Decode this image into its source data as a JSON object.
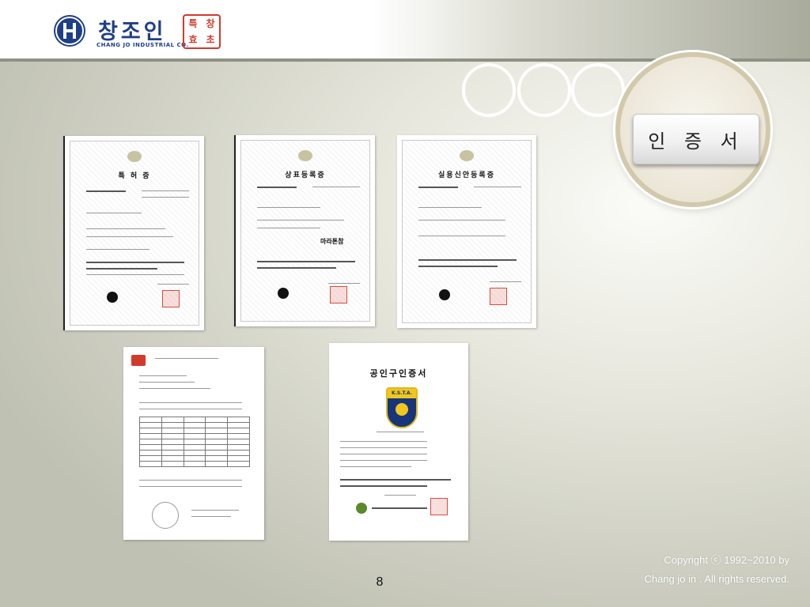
{
  "header": {
    "company_korean": "창조인",
    "company_english": "CHANG JO INDUSTRIAL CO.",
    "seal_text": [
      "특",
      "창",
      "효",
      "초"
    ]
  },
  "slide": {
    "title": "인 증 서",
    "page_number": "8"
  },
  "certificates": [
    {
      "heading": "특 허 증"
    },
    {
      "heading": "상표등록증",
      "brand": "마라톤참"
    },
    {
      "heading": "실용신안등록증"
    },
    {
      "heading": ""
    },
    {
      "heading": "공인구인증서",
      "badge": "K.S.T.A."
    }
  ],
  "copyright": {
    "line1": "Copyright ⓒ 1992~2010 by",
    "line2": "Chang jo in . All rights reserved."
  },
  "colors": {
    "brand_blue": "#1f3f86",
    "seal_red": "#d23a2c",
    "title_text": "#222222"
  }
}
